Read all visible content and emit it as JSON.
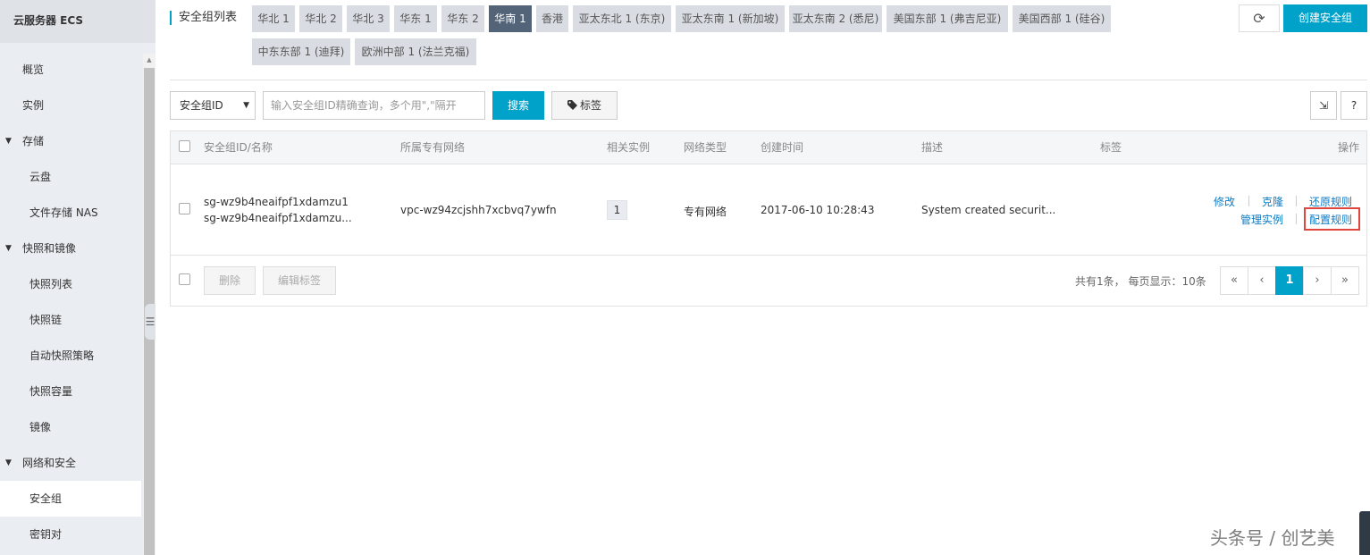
{
  "sidebar": {
    "title": "云服务器 ECS",
    "items": [
      {
        "label": "概览",
        "kind": "top"
      },
      {
        "label": "实例",
        "kind": "top"
      },
      {
        "label": "存储",
        "kind": "group"
      },
      {
        "label": "云盘",
        "kind": "sub"
      },
      {
        "label": "文件存储 NAS",
        "kind": "sub"
      },
      {
        "label": "快照和镜像",
        "kind": "group"
      },
      {
        "label": "快照列表",
        "kind": "sub"
      },
      {
        "label": "快照链",
        "kind": "sub"
      },
      {
        "label": "自动快照策略",
        "kind": "sub"
      },
      {
        "label": "快照容量",
        "kind": "sub"
      },
      {
        "label": "镜像",
        "kind": "sub"
      },
      {
        "label": "网络和安全",
        "kind": "group"
      },
      {
        "label": "安全组",
        "kind": "sub",
        "active": true
      },
      {
        "label": "密钥对",
        "kind": "sub"
      }
    ]
  },
  "header": {
    "page_title": "安全组列表",
    "regions": [
      "华北 1",
      "华北 2",
      "华北 3",
      "华东 1",
      "华东 2",
      "华南 1",
      "香港",
      "亚太东北 1 (东京)",
      "亚太东南 1 (新加坡)",
      "亚太东南 2 (悉尼)",
      "美国东部 1 (弗吉尼亚)",
      "美国西部 1 (硅谷)",
      "中东东部 1 (迪拜)",
      "欧洲中部 1 (法兰克福)"
    ],
    "active_region": "华南 1",
    "refresh_icon": "⟳",
    "create_label": "创建安全组"
  },
  "toolbar": {
    "filter_select": "安全组ID",
    "search_placeholder": "输入安全组ID精确查询，多个用\",\"隔开",
    "search_label": "搜索",
    "tag_label": "标签",
    "tag_icon": "tag-icon",
    "export_icon": "⇲",
    "help_label": "?"
  },
  "table": {
    "columns": [
      "安全组ID/名称",
      "所属专有网络",
      "相关实例",
      "网络类型",
      "创建时间",
      "描述",
      "标签",
      "操作"
    ],
    "rows": [
      {
        "id": "sg-wz9b4neaifpf1xdamzu1",
        "name": "sg-wz9b4neaifpf1xdamzu...",
        "vpc": "vpc-wz94zcjshh7xcbvq7ywfn",
        "instances": "1",
        "network_type": "专有网络",
        "created": "2017-06-10 10:28:43",
        "description": "System created securit...",
        "tags": "",
        "actions": {
          "edit": "修改",
          "clone": "克隆",
          "restore": "还原规则",
          "manage": "管理实例",
          "configure": "配置规则"
        }
      }
    ],
    "footer": {
      "delete_label": "删除",
      "edit_tags_label": "编辑标签",
      "summary": "共有1条， 每页显示：10条",
      "pager": {
        "first": "«",
        "prev": "‹",
        "current": "1",
        "next": "›",
        "last": "»"
      }
    }
  },
  "watermark": "头条号 / 创艺美",
  "colors": {
    "accent": "#00a2ca",
    "active_tab": "#546478",
    "link": "#0b7bc6",
    "highlight": "#e0463d"
  }
}
